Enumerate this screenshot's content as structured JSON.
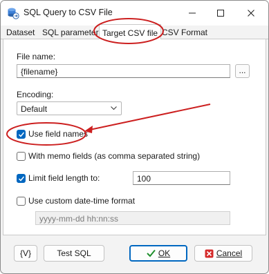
{
  "window": {
    "title": "SQL Query to CSV File",
    "icon": "database-to-file-icon",
    "controls": [
      "minimize-icon",
      "maximize-icon",
      "close-icon"
    ]
  },
  "tabs": [
    {
      "label": "Dataset",
      "active": false
    },
    {
      "label": "SQL parameters",
      "active": false
    },
    {
      "label": "Target CSV file",
      "active": true
    },
    {
      "label": "CSV Format",
      "active": false
    }
  ],
  "form": {
    "file_name_label": "File name:",
    "file_name_value": "{filename}",
    "browse_label": "...",
    "encoding_label": "Encoding:",
    "encoding_value": "Default",
    "use_field_names": {
      "label": "Use field names",
      "checked": true
    },
    "with_memo_fields": {
      "label": "With memo fields (as comma separated string)",
      "checked": false
    },
    "limit_field_length": {
      "label": "Limit field length to:",
      "checked": true,
      "value": "100"
    },
    "custom_datetime": {
      "label": "Use custom date-time format",
      "checked": false,
      "value": "yyyy-mm-dd hh:nn:ss"
    }
  },
  "footer": {
    "variables_label": "{V}",
    "test_sql_label": "Test SQL",
    "ok_label": "OK",
    "cancel_label": "Cancel"
  },
  "annotation_color": "#cc1f1f",
  "accent_color": "#0067c0"
}
